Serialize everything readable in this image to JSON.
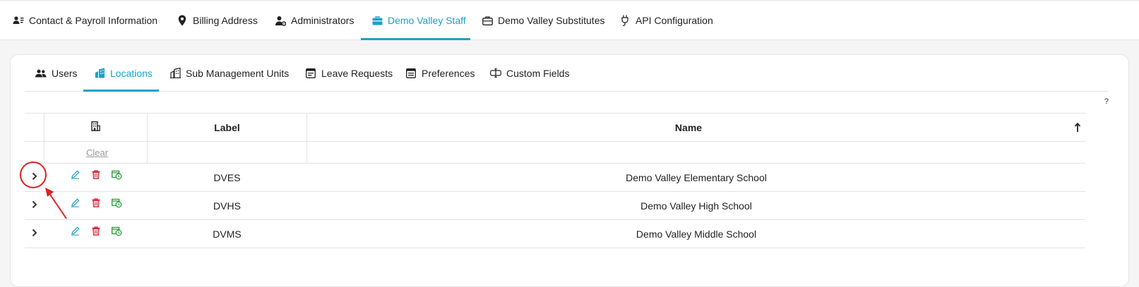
{
  "top_tabs": [
    {
      "label": "Contact & Payroll Information",
      "icon": "contact-card-icon"
    },
    {
      "label": "Billing Address",
      "icon": "map-pin-icon"
    },
    {
      "label": "Administrators",
      "icon": "admin-user-icon"
    },
    {
      "label": "Demo Valley Staff",
      "icon": "briefcase-icon",
      "active": true
    },
    {
      "label": "Demo Valley Substitutes",
      "icon": "briefcase-outline-icon"
    },
    {
      "label": "API Configuration",
      "icon": "plug-icon"
    }
  ],
  "sub_tabs": [
    {
      "label": "Users",
      "icon": "users-icon"
    },
    {
      "label": "Locations",
      "icon": "buildings-icon",
      "active": true
    },
    {
      "label": "Sub Management Units",
      "icon": "building-outline-icon"
    },
    {
      "label": "Leave Requests",
      "icon": "calendar-form-icon"
    },
    {
      "label": "Preferences",
      "icon": "preferences-icon"
    },
    {
      "label": "Custom Fields",
      "icon": "custom-fields-icon"
    }
  ],
  "help_label": "?",
  "grid": {
    "columns": {
      "label": "Label",
      "name": "Name"
    },
    "clear_label": "Clear",
    "rows": [
      {
        "label": "DVES",
        "name": "Demo Valley Elementary School"
      },
      {
        "label": "DVHS",
        "name": "Demo Valley High School"
      },
      {
        "label": "DVMS",
        "name": "Demo Valley Middle School"
      }
    ]
  },
  "colors": {
    "accent": "#1da1c8",
    "delete": "#d9263a",
    "assign": "#2e9a3e",
    "annotation": "#e02020"
  }
}
